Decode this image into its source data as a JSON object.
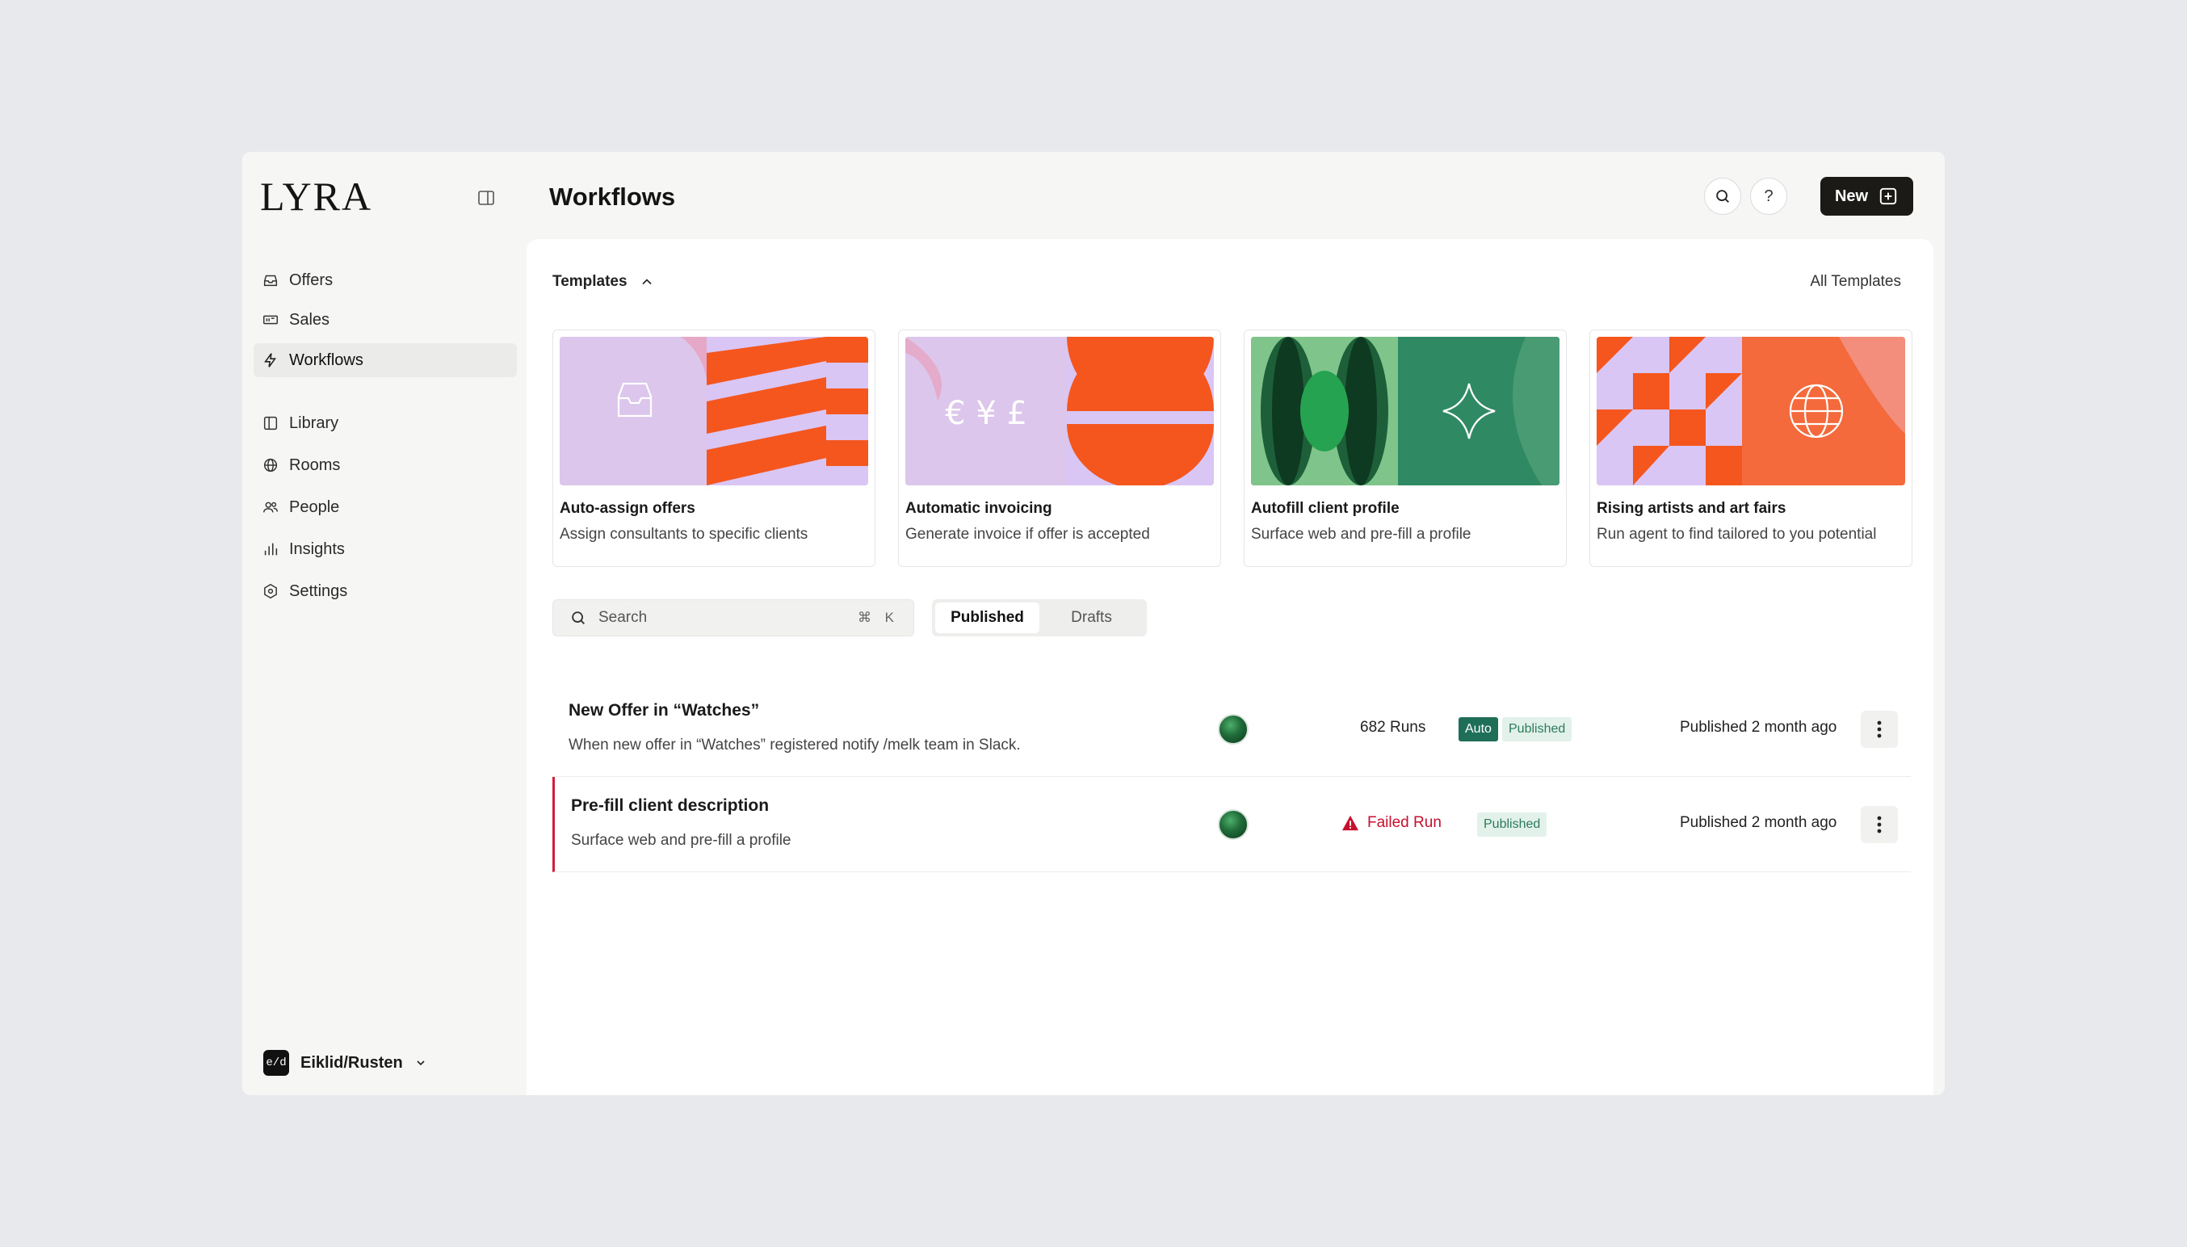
{
  "app": {
    "logo": "LYRA",
    "page_title": "Workflows"
  },
  "sidebar": {
    "items": [
      {
        "label": "Offers",
        "icon": "inbox-icon"
      },
      {
        "label": "Sales",
        "icon": "ticket-icon"
      },
      {
        "label": "Workflows",
        "icon": "lightning-icon",
        "active": true
      },
      {
        "label": "Library",
        "icon": "book-icon"
      },
      {
        "label": "Rooms",
        "icon": "globe-icon"
      },
      {
        "label": "People",
        "icon": "people-icon"
      },
      {
        "label": "Insights",
        "icon": "bar-chart-icon"
      },
      {
        "label": "Settings",
        "icon": "hexagon-settings-icon"
      }
    ],
    "workspace": {
      "badge": "e/d",
      "name": "Eiklid/Rusten"
    }
  },
  "header": {
    "help_label": "?",
    "new_label": "New"
  },
  "templates": {
    "label": "Templates",
    "all_label": "All Templates",
    "cards": [
      {
        "title": "Auto-assign offers",
        "desc": "Assign consultants to specific clients"
      },
      {
        "title": "Automatic invoicing",
        "desc": "Generate invoice if offer is accepted",
        "art_text": "€ ¥ £"
      },
      {
        "title": "Autofill client profile",
        "desc": "Surface web and pre-fill a profile"
      },
      {
        "title": "Rising artists and art fairs",
        "desc": "Run agent to find tailored to you potential"
      }
    ]
  },
  "search": {
    "placeholder": "Search",
    "shortcut": "⌘ K"
  },
  "tabs": [
    {
      "label": "Published",
      "active": true
    },
    {
      "label": "Drafts"
    }
  ],
  "workflows": [
    {
      "title": "New Offer in “Watches”",
      "desc": "When new offer in “Watches” registered notify /melk team in Slack.",
      "runs": "682 Runs",
      "badges": [
        "Auto",
        "Published"
      ],
      "published": "Published 2 month ago"
    },
    {
      "title": "Pre-fill client description",
      "desc": "Surface web and pre-fill a profile",
      "status": "Failed Run",
      "badges": [
        "Published"
      ],
      "published": "Published 2 month ago"
    }
  ],
  "colors": {
    "accent_dark": "#1b1a17",
    "lavender": "#d9c6f5",
    "orange": "#f5561e",
    "green": "#2e8b5e",
    "error": "#c8102e",
    "badge_auto": "#1f6e57"
  }
}
